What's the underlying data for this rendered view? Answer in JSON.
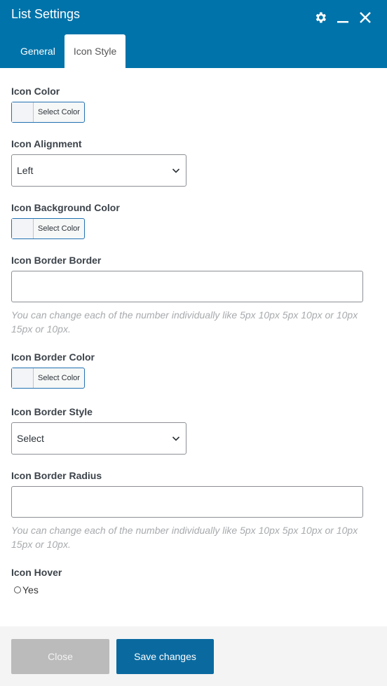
{
  "header": {
    "title": "List Settings",
    "icons": [
      "gear-icon",
      "minimize-icon",
      "close-icon"
    ],
    "bg_color": "#0073aa"
  },
  "tabs": [
    {
      "label": "General",
      "active": false
    },
    {
      "label": "Icon Style",
      "active": true
    }
  ],
  "fields": {
    "icon_color": {
      "label": "Icon Color",
      "button": "Select Color"
    },
    "icon_alignment": {
      "label": "Icon Alignment",
      "value": "Left"
    },
    "icon_bg_color": {
      "label": "Icon Background Color",
      "button": "Select Color"
    },
    "icon_border_border": {
      "label": "Icon Border Border",
      "value": "",
      "help": "You can change each of the number individually like 5px 10px 5px 10px or 10px 15px or 10px."
    },
    "icon_border_color": {
      "label": "Icon Border Color",
      "button": "Select Color"
    },
    "icon_border_style": {
      "label": "Icon Border Style",
      "value": "Select"
    },
    "icon_border_radius": {
      "label": "Icon Border Radius",
      "value": "",
      "help": "You can change each of the number individually like 5px 10px 5px 10px or 10px 15px or 10px."
    },
    "icon_hover": {
      "label": "Icon Hover",
      "option": "Yes",
      "checked": false
    }
  },
  "footer": {
    "close_label": "Close",
    "save_label": "Save changes"
  }
}
